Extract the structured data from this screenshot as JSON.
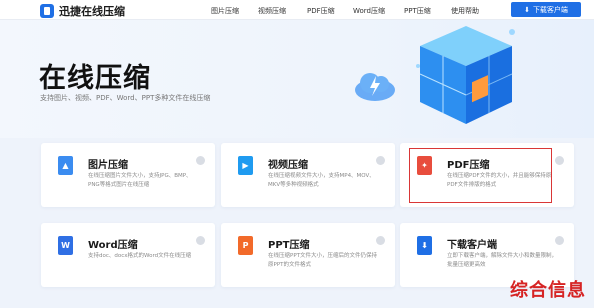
{
  "header": {
    "logo_text": "迅捷在线压缩",
    "nav": [
      "图片压缩",
      "视频压缩",
      "PDF压缩",
      "Word压缩",
      "PPT压缩",
      "使用帮助"
    ],
    "download_button": "下载客户端"
  },
  "hero": {
    "title": "在线压缩",
    "subtitle": "支持图片、视频、PDF、Word、PPT多种文件在线压缩"
  },
  "cards": [
    {
      "title": "图片压缩",
      "desc": "在线压缩图片文件大小，支持JPG、BMP、PNG等格式图片在线压缩",
      "icon": "image-icon",
      "color": "#3b8cf0"
    },
    {
      "title": "视频压缩",
      "desc": "在线压缩视频文件大小，支持MP4、MOV、MKV等多种视频格式",
      "icon": "video-icon",
      "color": "#1f9bf0"
    },
    {
      "title": "PDF压缩",
      "desc": "在线压缩PDF文件的大小，并且能够保持原PDF文件排版的格式",
      "icon": "pdf-icon",
      "color": "#e84d3d"
    },
    {
      "title": "Word压缩",
      "desc": "支持doc、docx格式的Word文件在线压缩",
      "icon": "word-icon",
      "color": "#2f6fe4"
    },
    {
      "title": "PPT压缩",
      "desc": "在线压缩PPT文件大小，压缩后的文件仍保持原PPT的文件格式",
      "icon": "ppt-icon",
      "color": "#f26a2a"
    },
    {
      "title": "下载客户端",
      "desc": "立即下载客户端，解除文件大小和数量限制，批量压缩更高效",
      "icon": "download-icon",
      "color": "#1f6fe5"
    }
  ],
  "watermark": "综合信息"
}
